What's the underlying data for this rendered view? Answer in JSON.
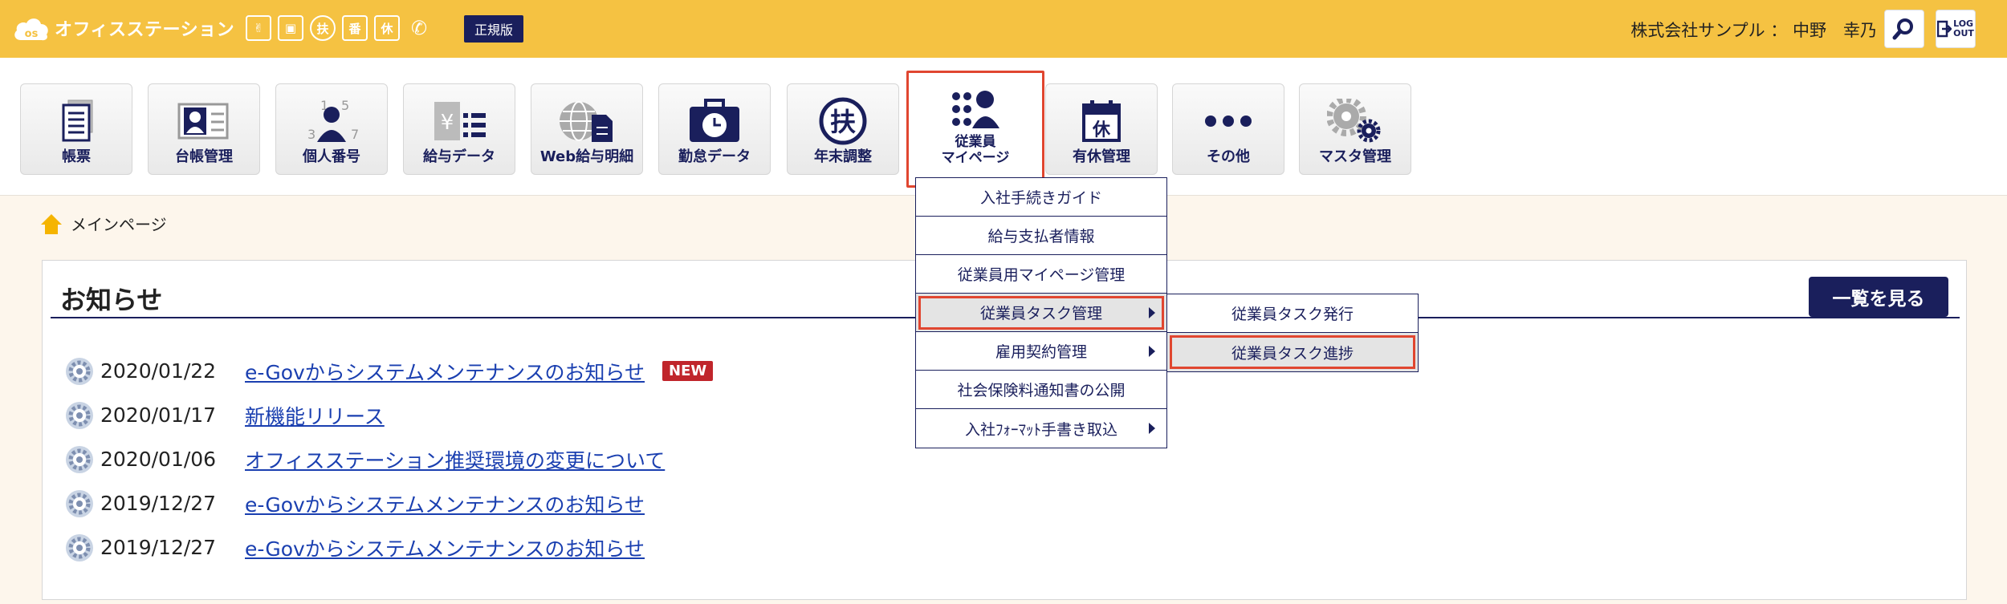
{
  "header": {
    "app_title": "オフィスステーション",
    "icon_names": [
      "peace-icon",
      "briefcase-icon",
      "fu-icon",
      "numbered-icon",
      "kyu-icon",
      "phone-icon"
    ],
    "icon_glyphs": [
      "✌",
      "▣",
      "扶",
      "番",
      "休",
      "✆"
    ],
    "edition_badge": "正規版",
    "user_label": "株式会社サンプル ： 中野　幸乃",
    "logout_label_1": "LOG",
    "logout_label_2": "OUT"
  },
  "nav": {
    "tiles": [
      {
        "label": "帳票"
      },
      {
        "label": "台帳管理"
      },
      {
        "label": "個人番号"
      },
      {
        "label": "給与データ"
      },
      {
        "label": "Web給与明細"
      },
      {
        "label": "勤怠データ"
      },
      {
        "label": "年末調整"
      },
      {
        "label_1": "従業員",
        "label_2": "マイページ"
      },
      {
        "label": "有休管理"
      },
      {
        "label": "その他"
      },
      {
        "label": "マスタ管理"
      }
    ]
  },
  "breadcrumb": {
    "label": "メインページ"
  },
  "notices": {
    "title": "お知らせ",
    "list_button": "一覧を見る",
    "items": [
      {
        "date": "2020/01/22",
        "text": "e-Govからシステムメンテナンスのお知らせ",
        "badge": "NEW"
      },
      {
        "date": "2020/01/17",
        "text": "新機能リリース"
      },
      {
        "date": "2020/01/06",
        "text": "オフィスステーション推奨環境の変更について"
      },
      {
        "date": "2019/12/27",
        "text": "e-Govからシステムメンテナンスのお知らせ"
      },
      {
        "date": "2019/12/27",
        "text": "e-Govからシステムメンテナンスのお知らせ"
      }
    ]
  },
  "dropdown": {
    "items": [
      {
        "label": "入社手続きガイド"
      },
      {
        "label": "給与支払者情報"
      },
      {
        "label": "従業員用マイページ管理"
      },
      {
        "label": "従業員タスク管理"
      },
      {
        "label": "雇用契約管理"
      },
      {
        "label": "社会保険料通知書の公開"
      },
      {
        "label": "入社ﾌｫｰﾏｯﾄ手書き取込"
      }
    ]
  },
  "submenu": {
    "items": [
      {
        "label": "従業員タスク発行"
      },
      {
        "label": "従業員タスク進捗"
      }
    ]
  },
  "colors": {
    "header": "#f5c242",
    "navy": "#1a1f5c",
    "highlight": "#e04630",
    "link": "#1a3fb0",
    "new": "#c0252b"
  }
}
